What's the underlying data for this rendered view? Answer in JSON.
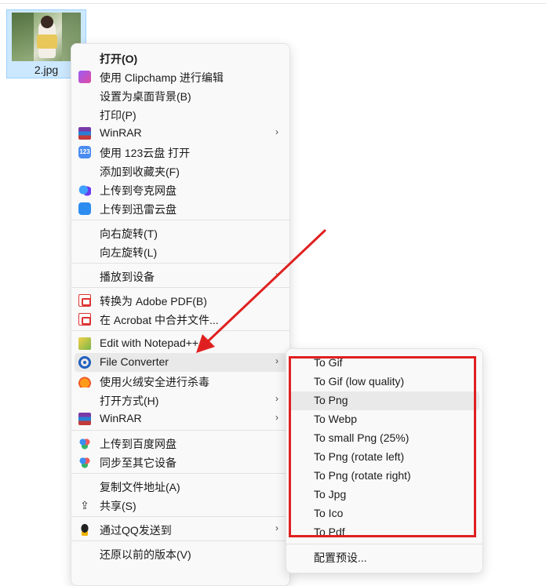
{
  "file": {
    "name": "2.jpg"
  },
  "main_menu": {
    "items": [
      {
        "label": "打开(O)",
        "icon": "",
        "submenu": false,
        "bold": true
      },
      {
        "label": "使用 Clipchamp 进行编辑",
        "icon": "clipchamp-icon",
        "submenu": false
      },
      {
        "label": "设置为桌面背景(B)",
        "icon": "",
        "submenu": false
      },
      {
        "label": "打印(P)",
        "icon": "",
        "submenu": false
      },
      {
        "label": "WinRAR",
        "icon": "winrar-icon",
        "submenu": true
      },
      {
        "label": "使用 123云盘 打开",
        "icon": "123pan-icon",
        "submenu": false
      },
      {
        "label": "添加到收藏夹(F)",
        "icon": "",
        "submenu": false
      },
      {
        "label": "上传到夸克网盘",
        "icon": "quark-icon",
        "submenu": false
      },
      {
        "label": "上传到迅雷云盘",
        "icon": "xunlei-icon",
        "submenu": false
      },
      {
        "label": "向右旋转(T)",
        "icon": "",
        "submenu": false
      },
      {
        "label": "向左旋转(L)",
        "icon": "",
        "submenu": false
      },
      {
        "label": "播放到设备",
        "icon": "",
        "submenu": true
      },
      {
        "label": "转换为 Adobe PDF(B)",
        "icon": "pdf-icon",
        "submenu": false
      },
      {
        "label": "在 Acrobat 中合并文件...",
        "icon": "acrobat-icon",
        "submenu": false
      },
      {
        "label": "Edit with Notepad++",
        "icon": "notepad-icon",
        "submenu": false
      },
      {
        "label": "File Converter",
        "icon": "file-converter-icon",
        "submenu": true
      },
      {
        "label": "使用火绒安全进行杀毒",
        "icon": "huorong-icon",
        "submenu": false
      },
      {
        "label": "打开方式(H)",
        "icon": "",
        "submenu": true
      },
      {
        "label": "WinRAR",
        "icon": "winrar-icon",
        "submenu": true
      },
      {
        "label": "上传到百度网盘",
        "icon": "baidu-icon",
        "submenu": false
      },
      {
        "label": "同步至其它设备",
        "icon": "baidu-sync-icon",
        "submenu": false
      },
      {
        "label": "复制文件地址(A)",
        "icon": "",
        "submenu": false
      },
      {
        "label": "共享(S)",
        "icon": "share-icon",
        "submenu": false
      },
      {
        "label": "通过QQ发送到",
        "icon": "qq-icon",
        "submenu": true
      },
      {
        "label": "还原以前的版本(V)",
        "icon": "",
        "submenu": false
      }
    ],
    "chevron": "›"
  },
  "sub_menu": {
    "items": [
      {
        "label": "To Gif"
      },
      {
        "label": "To Gif (low quality)"
      },
      {
        "label": "To Png"
      },
      {
        "label": "To Webp"
      },
      {
        "label": "To small Png (25%)"
      },
      {
        "label": "To Png (rotate left)"
      },
      {
        "label": "To Png (rotate right)"
      },
      {
        "label": "To Jpg"
      },
      {
        "label": "To Ico"
      },
      {
        "label": "To Pdf"
      },
      {
        "label": "配置预设..."
      }
    ]
  },
  "colors": {
    "annotation": "#e02020",
    "hover": "#e9e9e9",
    "selection": "#cce8ff"
  }
}
